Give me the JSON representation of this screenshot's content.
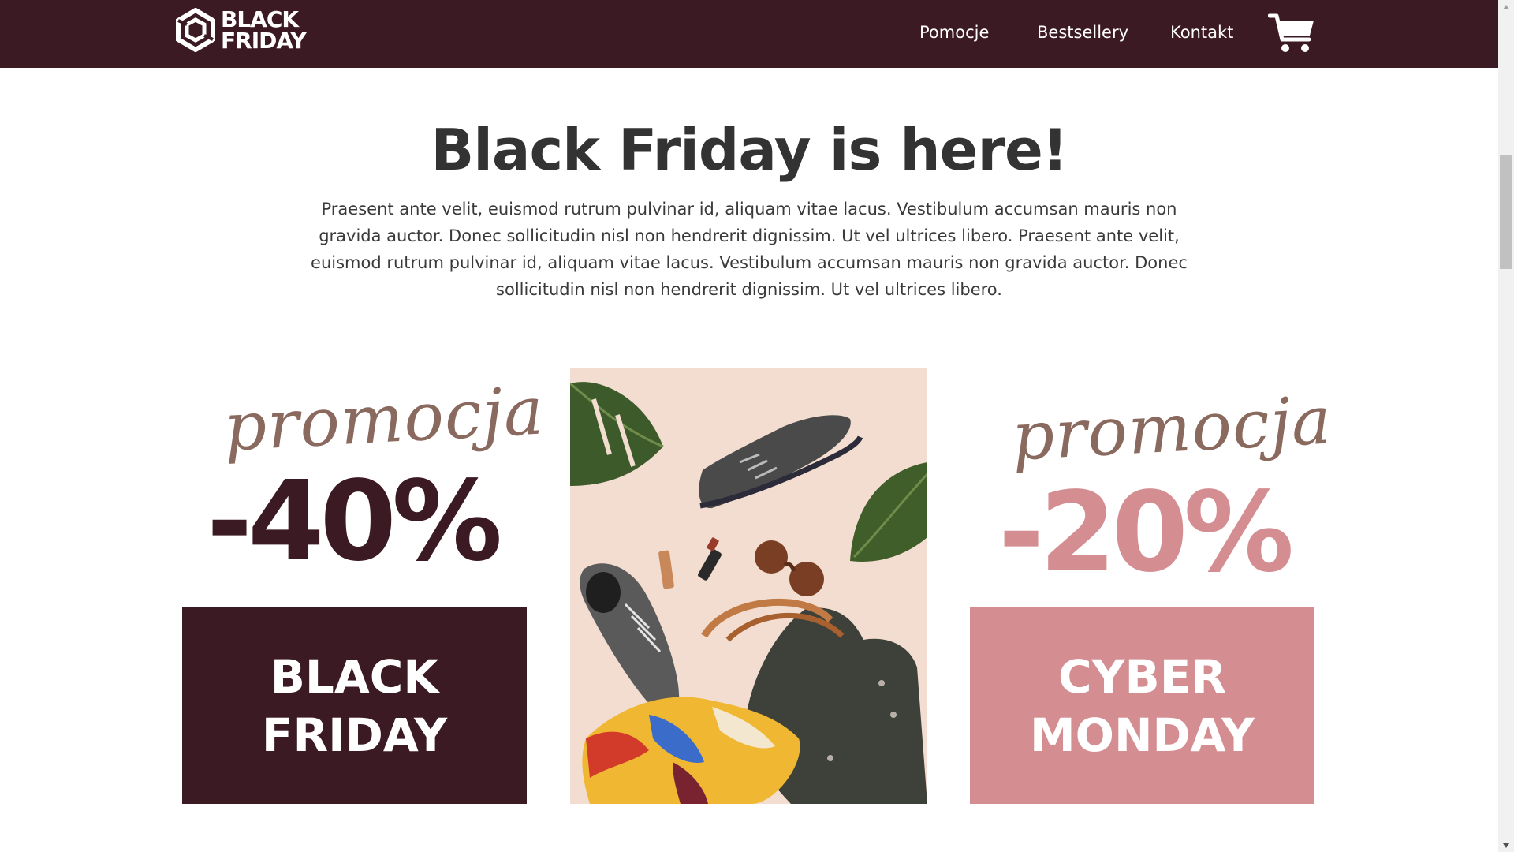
{
  "header": {
    "logo_line1": "BLACK",
    "logo_line2": "FRIDAY",
    "nav": [
      "Pomocje",
      "Bestsellery",
      "Kontakt"
    ],
    "cart_icon": "shopping-cart-icon",
    "background": "#3c1a23"
  },
  "hero": {
    "title": "Black Friday is here!",
    "text": "Praesent ante velit, euismod rutrum pulvinar id, aliquam vitae lacus. Vestibulum accumsan mauris non gravida auctor. Donec sollicitudin nisl non hendrerit dignissim. Ut vel ultrices libero. Praesent ante velit, euismod rutrum pulvinar id, aliquam vitae lacus. Vestibulum accumsan mauris non gravida auctor. Donec sollicitudin nisl non hendrerit dignissim. Ut vel ultrices libero."
  },
  "promos": [
    {
      "script": "promocja",
      "discount": "-40%",
      "line1": "BLACK",
      "line2": "FRIDAY",
      "color": "#3c1a23"
    },
    {
      "script": "promocja",
      "discount": "-20%",
      "line1": "CYBER",
      "line2": "MONDAY",
      "color": "#d48e92"
    }
  ],
  "photo": {
    "icon": "product-flatlay-image"
  }
}
